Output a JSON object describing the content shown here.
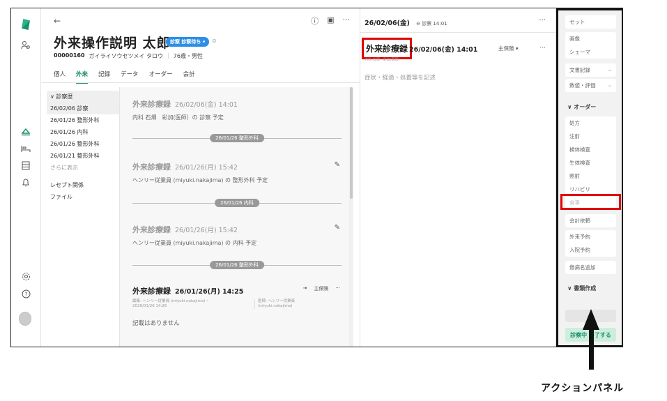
{
  "icons": {
    "logo": "app-logo-icon",
    "left_rail": [
      "users-search-icon",
      "reception-icon",
      "bed-icon",
      "list-icon",
      "bell-icon",
      "gear-icon",
      "help-icon",
      "avatar"
    ],
    "back": "←",
    "header_icons": [
      "ⓘ",
      "▣",
      "···"
    ]
  },
  "patient": {
    "name": "外来操作説明 太郎",
    "badge": "診察 診察待ち ▾",
    "id": "00000160",
    "kana": "ガイライソウセツメイ タロウ",
    "age_sex": "76歳・男性"
  },
  "tabs": [
    "個人",
    "外来",
    "記録",
    "データ",
    "オーダー",
    "会計"
  ],
  "history": {
    "header": "∨ 診察歴",
    "items": [
      "26/02/06 診察",
      "26/01/26 整形外科",
      "26/01/26 内科",
      "26/01/26 整形外科",
      "26/01/21 整形外科"
    ],
    "more": "さらに表示",
    "links": [
      "レセプト関係",
      "ファイル"
    ]
  },
  "timeline": {
    "e1": {
      "title": "外来診療録",
      "date": "26/02/06(金) 14:01",
      "sub": "内科 石畑　彩加(医師）の 診察 予定"
    },
    "d1": "26/01/26 整形外科",
    "e2": {
      "title": "外来診療録",
      "date": "26/01/26(月) 15:42",
      "sub": "ヘンリー従業員 (miyuki.nakajima) の 整形外科 予定"
    },
    "d2": "26/01/26 内科",
    "e3": {
      "title": "外来診療録",
      "date": "26/01/26(月) 15:42",
      "sub": "ヘンリー従業員 (miyuki.nakajima) の 内科 予定"
    },
    "d3": "26/01/26 整形外科",
    "e4": {
      "title": "外来診療録",
      "date": "26/01/26(月) 14:25",
      "insurance": "主保険",
      "editor": "編集: ヘンリー従業員 (miyuki.nakajima)・",
      "edit_time": "2026/01/26 14:26",
      "doctor": "医師: ヘンリー従業員",
      "doctor_id": "(miyuki.nakajima)",
      "body": "記載はありません"
    }
  },
  "note": {
    "top_date": "26/02/06(金)",
    "top_sub": "⊖ 診察 14:01",
    "title": "外来診療録",
    "date": "26/02/06(金) 14:01",
    "sub": "内科 石畑　彩加(医師)",
    "insurance": "主保険 ▾",
    "placeholder": "症状・経過・処置等を記述"
  },
  "actions": {
    "set": "セット",
    "group1": [
      "画像",
      "シェーマ"
    ],
    "doc": "文書記録",
    "eval": "数値・評価",
    "order_header": "∨ オーダー",
    "orders": [
      "処方",
      "注射",
      "検体検査",
      "生体検査",
      "照射",
      "リハビリ",
      "食事"
    ],
    "billing": "会計依頼",
    "reserve": [
      "外来予約",
      "入院予約"
    ],
    "disease": "傷病名追加",
    "doc_header": "∨ 書類作成",
    "end": "診察中 終了する"
  },
  "caption": "アクションパネル"
}
